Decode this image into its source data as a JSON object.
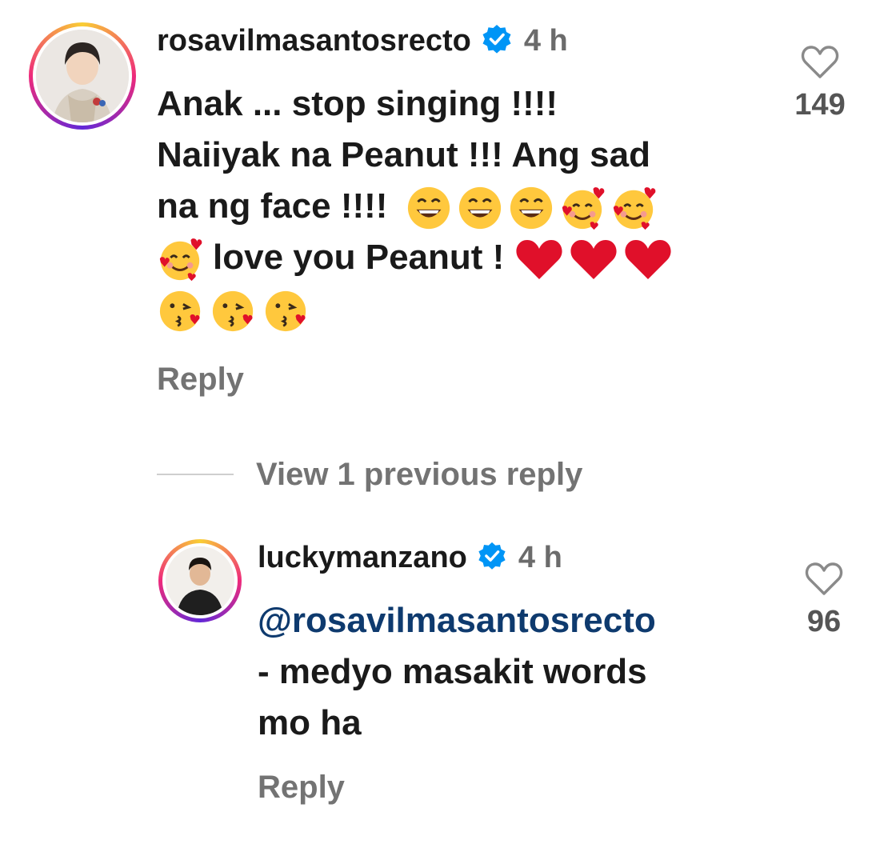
{
  "comments": [
    {
      "username": "rosavilmasantosrecto",
      "time": "4 h",
      "lines": [
        "Anak ... stop singing !!!!",
        "Naiiyak na Peanut !!! Ang sad",
        "na ng face !!!!",
        "love you Peanut !"
      ],
      "likes": "149",
      "reply_label": "Reply"
    },
    {
      "username": "luckymanzano",
      "time": "4 h",
      "mention": "@rosavilmasantosrecto",
      "lines": [
        "- medyo masakit words",
        "mo ha"
      ],
      "likes": "96",
      "reply_label": "Reply"
    }
  ],
  "view_replies_label": "View 1 previous reply",
  "colors": {
    "verified": "#0095f6",
    "mention": "#0e3a6e",
    "secondary_text": "#737373",
    "heart": "#e0102a"
  }
}
